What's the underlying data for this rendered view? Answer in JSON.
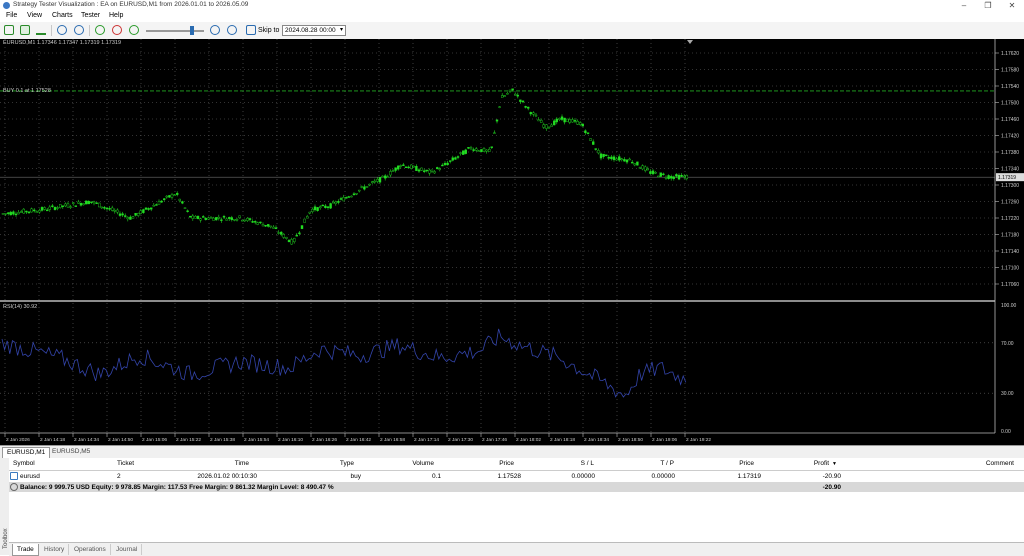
{
  "window": {
    "title": "Strategy Tester Visualization : EA on EURUSD,M1 from 2026.01.01 to 2026.05.09"
  },
  "menu": [
    "File",
    "View",
    "Charts",
    "Tester",
    "Help"
  ],
  "toolbar": {
    "skip_label": "Skip to",
    "skip_date": "2024.08.28 00:00"
  },
  "chart": {
    "main_info": "EURUSD,M1  1.17346  1.17347  1.17319  1.17319",
    "order_label": "BUY 0.1 at 1.17528",
    "price_ticks": [
      "1.17620",
      "1.17580",
      "1.17540",
      "1.17500",
      "1.17460",
      "1.17420",
      "1.17380",
      "1.17340",
      "1.17300",
      "1.17260",
      "1.17220",
      "1.17180",
      "1.17140",
      "1.17100",
      "1.17060"
    ],
    "current_price": "1.17319",
    "rsi_label": "RSI(14) 30.92",
    "rsi_ticks": [
      "100.00",
      "70.00",
      "30.00",
      "0.00"
    ],
    "time_labels": [
      "2 Jan 2026",
      "2 Jan 14:18",
      "2 Jan 14:34",
      "2 Jan 14:50",
      "2 Jan 15:06",
      "2 Jan 15:22",
      "2 Jan 15:38",
      "2 Jan 15:54",
      "2 Jan 16:10",
      "2 Jan 16:26",
      "2 Jan 16:42",
      "2 Jan 16:58",
      "2 Jan 17:14",
      "2 Jan 17:30",
      "2 Jan 17:46",
      "2 Jan 18:02",
      "2 Jan 18:18",
      "2 Jan 18:34",
      "2 Jan 18:50",
      "2 Jan 19:06",
      "2 Jan 19:22"
    ],
    "colors": {
      "bg": "#000000",
      "candle": "#22dd22",
      "grid": "#666666",
      "rsi": "#3344aa",
      "order": "#22aa22"
    }
  },
  "chart_tabs": [
    "EURUSD,M1",
    "EURUSD,M5"
  ],
  "trade_table": {
    "headers": [
      "Symbol",
      "Ticket",
      "Time",
      "Type",
      "Volume",
      "Price",
      "S / L",
      "T / P",
      "Price",
      "Profit",
      "Comment"
    ],
    "rows": [
      {
        "symbol": "eurusd",
        "ticket": "2",
        "time": "2026.01.02 00:10:30",
        "type": "buy",
        "volume": "0.1",
        "price": "1.17528",
        "sl": "0.00000",
        "tp": "0.00000",
        "current": "1.17319",
        "profit": "-20.90",
        "comment": ""
      }
    ],
    "balance_line": "Balance: 9 999.75 USD  Equity: 9 978.85  Margin: 117.53  Free Margin: 9 861.32  Margin Level: 8 490.47 %",
    "balance_profit": "-20.90"
  },
  "bottom_tabs": [
    "Trade",
    "History",
    "Operations",
    "Journal"
  ],
  "sidebar_label": "Toolbox"
}
